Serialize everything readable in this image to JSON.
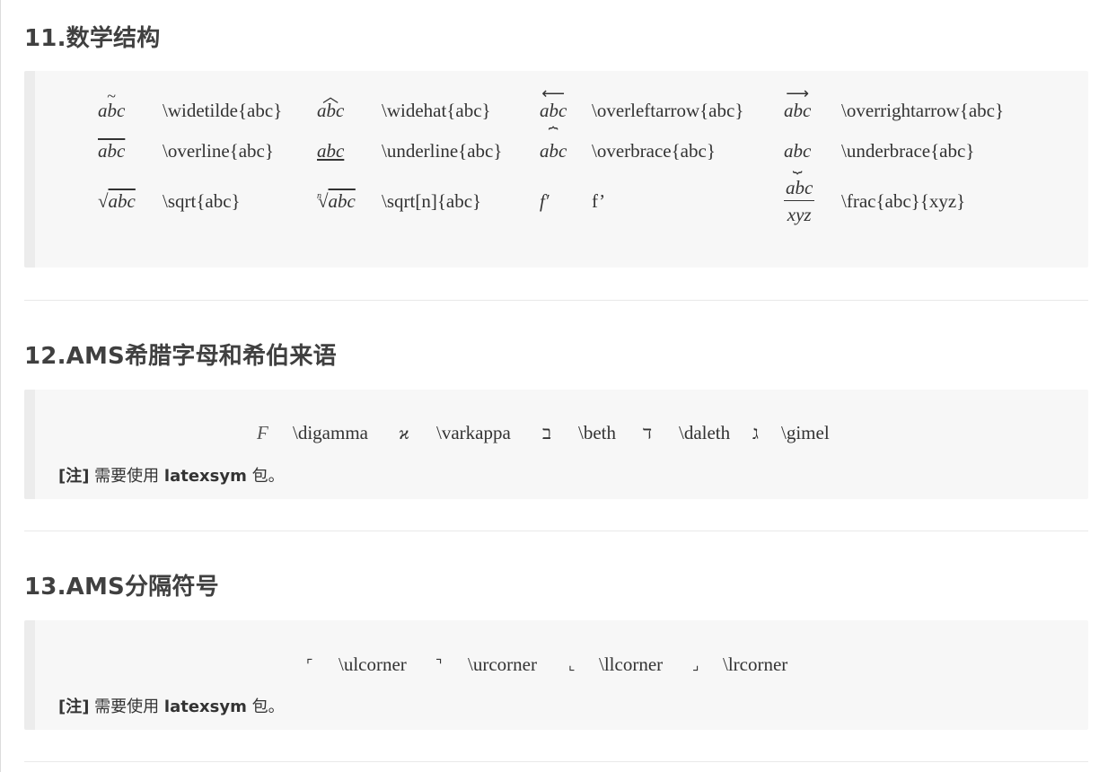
{
  "sections": [
    {
      "title": "11.数学结构",
      "rows": [
        [
          {
            "sym": "abc",
            "cmd": "\\widetilde{abc}"
          },
          {
            "sym": "abc",
            "cmd": "\\widehat{abc}"
          },
          {
            "sym": "abc",
            "cmd": "\\overleftarrow{abc}"
          },
          {
            "sym": "abc",
            "cmd": "\\overrightarrow{abc}"
          }
        ],
        [
          {
            "sym": "abc",
            "cmd": "\\overline{abc}"
          },
          {
            "sym": "abc",
            "cmd": "\\underline{abc}"
          },
          {
            "sym": "abc",
            "cmd": "\\overbrace{abc}"
          },
          {
            "sym": "abc",
            "cmd": "\\underbrace{abc}"
          }
        ],
        [
          {
            "sym": "abc",
            "cmd": "\\sqrt{abc}"
          },
          {
            "sym": "abc",
            "idx": "n",
            "cmd": "\\sqrt[n]{abc}"
          },
          {
            "sym": "f′",
            "cmd": "f’"
          },
          {
            "num": "abc",
            "den": "xyz",
            "cmd": "\\frac{abc}{xyz}"
          }
        ]
      ]
    },
    {
      "title": "12.AMS希腊字母和希伯来语",
      "items": [
        {
          "sym": "Ϝ",
          "cmd": "\\digamma"
        },
        {
          "sym": "ϰ",
          "cmd": "\\varkappa"
        },
        {
          "sym": "ב",
          "cmd": "\\beth"
        },
        {
          "sym": "ד",
          "cmd": "\\daleth"
        },
        {
          "sym": "ג",
          "cmd": "\\gimel"
        }
      ],
      "note": {
        "tag": "[注]",
        "text1": " 需要使用 ",
        "pkg": "latexsym",
        "text2": " 包。"
      }
    },
    {
      "title": "13.AMS分隔符号",
      "items": [
        {
          "sym": "⌜",
          "cmd": "\\ulcorner"
        },
        {
          "sym": "⌝",
          "cmd": "\\urcorner"
        },
        {
          "sym": "⌞",
          "cmd": "\\llcorner"
        },
        {
          "sym": "⌟",
          "cmd": "\\lrcorner"
        }
      ],
      "note": {
        "tag": "[注]",
        "text1": " 需要使用 ",
        "pkg": "latexsym",
        "text2": " 包。"
      }
    }
  ]
}
